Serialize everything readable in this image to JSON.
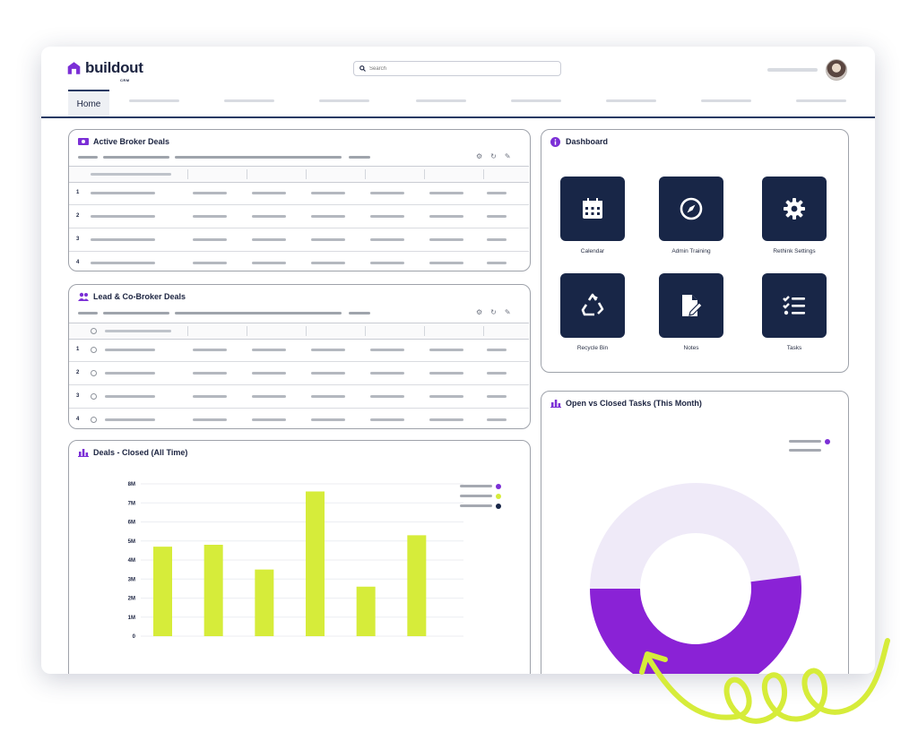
{
  "app": {
    "logo_text": "buildout",
    "logo_sub": "CRM",
    "brand_color": "#7b2fd6",
    "navy": "#182647"
  },
  "search": {
    "placeholder": "Search",
    "value": ""
  },
  "tabs": {
    "home_label": "Home"
  },
  "active_broker_deals": {
    "title": "Active Broker Deals",
    "rows": [
      "1",
      "2",
      "3",
      "4"
    ]
  },
  "lead_co_broker_deals": {
    "title": "Lead & Co-Broker Deals",
    "rows": [
      "1",
      "2",
      "3",
      "4"
    ]
  },
  "dashboard": {
    "title": "Dashboard",
    "tiles": [
      {
        "label": "Calendar",
        "icon": "calendar-icon"
      },
      {
        "label": "Admin Training",
        "icon": "compass-icon"
      },
      {
        "label": "Rethink Settings",
        "icon": "gear-icon"
      },
      {
        "label": "Recycle Bin",
        "icon": "recycle-icon"
      },
      {
        "label": "Notes",
        "icon": "note-edit-icon"
      },
      {
        "label": "Tasks",
        "icon": "checklist-icon"
      }
    ]
  },
  "deals_closed": {
    "title": "Deals - Closed (All Time)",
    "legend_colors": [
      "#7b2fd6",
      "#d6ec3a",
      "#182647"
    ]
  },
  "tasks_chart": {
    "title": "Open vs Closed Tasks (This Month)",
    "legend_colors": [
      "#7b2fd6",
      "#ffffff"
    ]
  },
  "chart_data": [
    {
      "type": "bar",
      "title": "Deals - Closed (All Time)",
      "yticks": [
        "0",
        "1M",
        "2M",
        "3M",
        "4M",
        "5M",
        "6M",
        "7M",
        "8M"
      ],
      "ylim": [
        0,
        8
      ],
      "values": [
        4.7,
        4.8,
        3.5,
        7.6,
        2.6,
        5.3
      ],
      "color": "#d6ec3a",
      "grid": true
    },
    {
      "type": "pie",
      "title": "Open vs Closed Tasks (This Month)",
      "values": [
        0.48,
        0.52
      ],
      "colors": [
        "#efeaf8",
        "#8a22d6"
      ],
      "donut": true
    }
  ]
}
